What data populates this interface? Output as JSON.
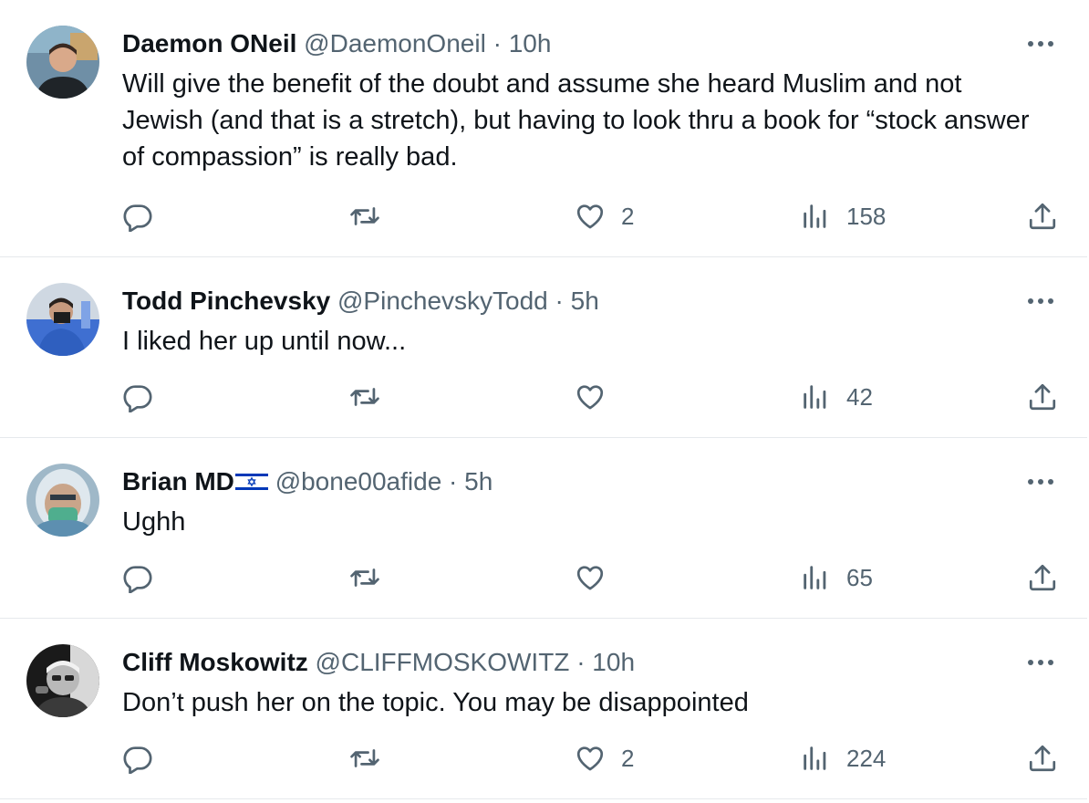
{
  "tweets": [
    {
      "name": "Daemon ONeil",
      "handle": "@DaemonOneil",
      "separator": "·",
      "time": "10h",
      "text": "Will give the benefit of the doubt and assume she heard Muslim and not Jewish (and that is a stretch), but having to look thru a book for “stock answer of compassion” is really bad.",
      "likes": "2",
      "views": "158"
    },
    {
      "name": "Todd Pinchevsky",
      "handle": "@PinchevskyTodd",
      "separator": "·",
      "time": "5h",
      "text": "I liked her up until now...",
      "likes": "",
      "views": "42"
    },
    {
      "name": "Brian MD",
      "name_flag": "israel-flag",
      "handle": "@bone00afide",
      "separator": "·",
      "time": "5h",
      "text": "Ughh",
      "likes": "",
      "views": "65"
    },
    {
      "name": "Cliff Moskowitz",
      "handle": "@CLIFFMOSKOWITZ",
      "separator": "·",
      "time": "10h",
      "text": "Don’t push her on the topic. You may be disappointed",
      "likes": "2",
      "views": "224"
    }
  ],
  "icons": {
    "reply": "reply-icon",
    "retweet": "retweet-icon",
    "like": "heart-icon",
    "views": "views-icon",
    "share": "share-icon",
    "more": "more-icon"
  },
  "colors": {
    "text": "#0f1419",
    "secondary": "#536471",
    "divider": "#e6e9ec",
    "flag_blue": "#0038b8"
  }
}
